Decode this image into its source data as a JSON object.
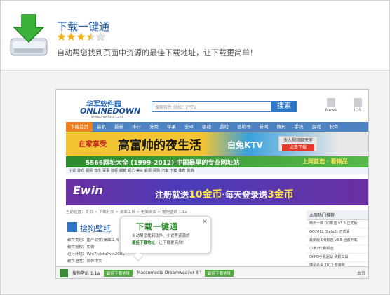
{
  "header": {
    "title": "下载一键通",
    "rating": 3.5,
    "description": "自动帮您找到页面中资源的最佳下载地址，让下载更简单！"
  },
  "screenshot": {
    "logo": {
      "cn": "华军软件园",
      "en": "ONLINEDOWN",
      "url": "www.newhua.com"
    },
    "search": {
      "placeholder": "搜索软件 例如：PPTV",
      "button": "搜索"
    },
    "top_icons": [
      "News",
      "iOS"
    ],
    "nav": [
      "下载首页",
      "装机",
      "最新",
      "排行",
      "分类",
      "苹果",
      "安卓",
      "驱动",
      "游戏",
      "说明书",
      "新闻",
      "数码",
      "手机",
      "游戏",
      "软件"
    ],
    "banner1": {
      "left_text": "在家享受",
      "main_text": "高富帅的夜生活",
      "brand": "白兔KTV",
      "btn_top": "多人视频聊天室",
      "btn": "点击下载"
    },
    "banner2": {
      "text": "5566网址大全 (1999-2012) 中国最早的专业网址站",
      "right": "上网首选 · 看精品"
    },
    "links": [
      "小说",
      "游戏",
      "视频",
      "音乐",
      "军事",
      "财经",
      "邮箱",
      "娱乐",
      "美女",
      "彩票",
      "网购",
      "汽车",
      "下载",
      "体育",
      "旅游"
    ],
    "banner3": {
      "logo": "Ewin",
      "text_before": "注册就送",
      "amount1": "10金币",
      "text_mid": "·每天登录送",
      "amount2": "3金币"
    },
    "breadcrumb": "当前位置：首页 > 下载分类 > 桌面工具 > 电脑桌面 > 搜狗壁纸 1.1a",
    "software": {
      "title": "搜狗壁纸",
      "meta": [
        "软件类别：国产软件/桌面工具",
        "软件授权：免费",
        "运行环境：Win7/vista/win2003",
        "软件语言：简体中文"
      ]
    },
    "sidebar": {
      "head": "本周热门推荐",
      "items": [
        "西瓜一体 QQ影音 v3.5 正式版",
        "QQ2012 (Beta3) 正式版",
        "最新版 QQ影音 v3.5 迅雷下载",
        "小米2代 刷机包",
        "OPPO手机驱动 刷机工具",
        "瑞星杀毒 2012 安装包"
      ]
    },
    "popup": {
      "title": "下载一键通",
      "close": "✕",
      "line1": "自动帮您找到软件、小说等资源的",
      "line2_bold": "最佳下载地址",
      "line2_rest": "，让下载更简单！"
    },
    "bottombar": {
      "item1_name": "搜狗壁纸 1.1a",
      "item1_btn": "最佳下载地址",
      "item2_name": "Maccomedia Dreamweaver 8''",
      "item2_btn": "最佳下载地址",
      "more": "本页"
    }
  }
}
